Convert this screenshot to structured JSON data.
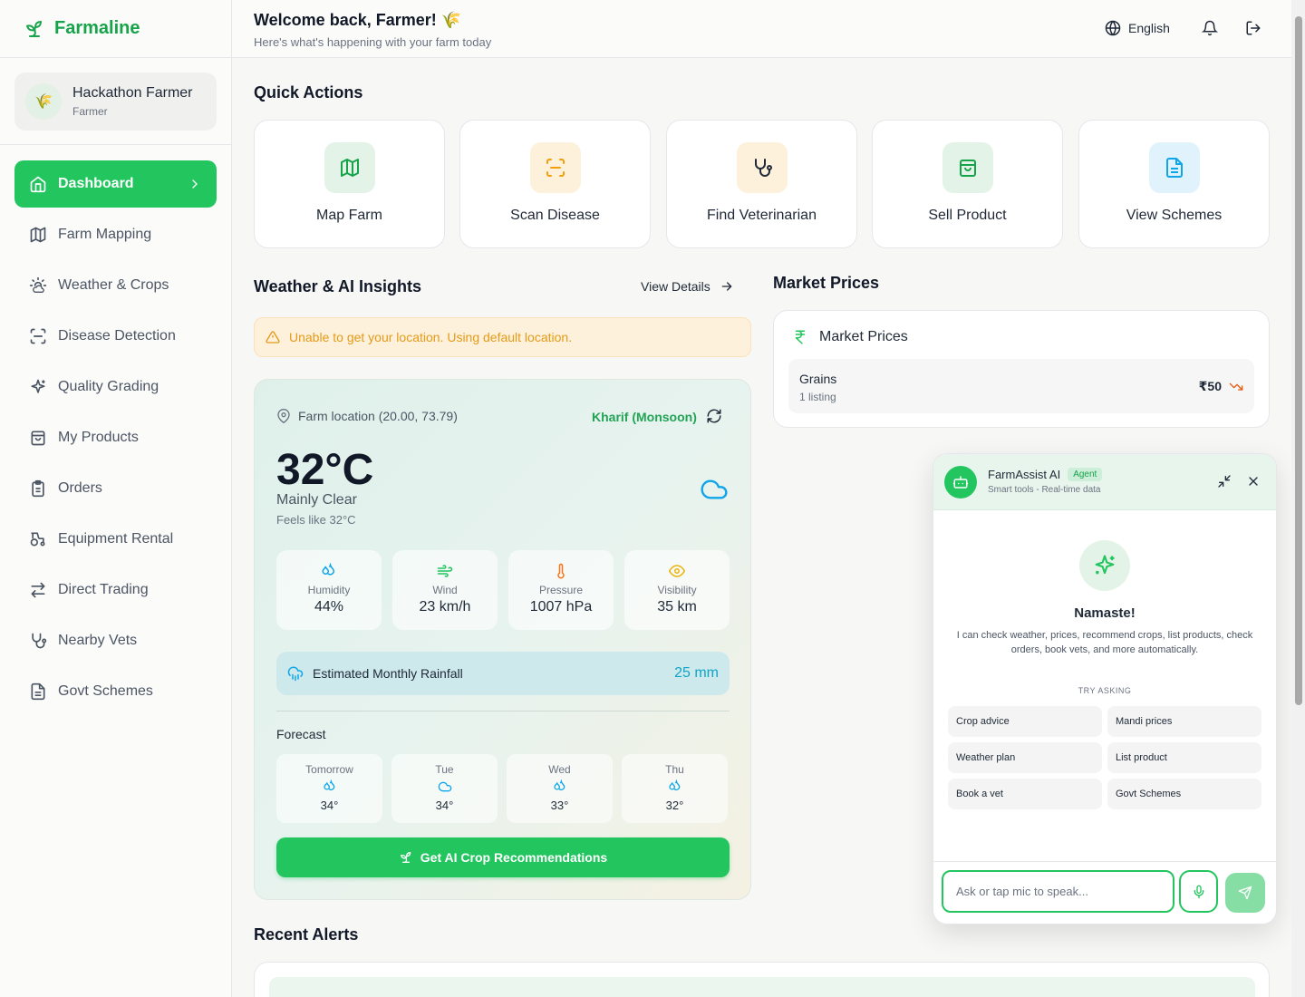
{
  "app": {
    "name": "Farmaline",
    "brand_color": "#16a34a"
  },
  "user": {
    "name": "Hackathon Farmer",
    "role": "Farmer",
    "avatar": "🌾"
  },
  "sidebar": {
    "items": [
      {
        "label": "Dashboard",
        "icon": "home-icon",
        "active": true
      },
      {
        "label": "Farm Mapping",
        "icon": "map-icon"
      },
      {
        "label": "Weather & Crops",
        "icon": "sun-cloud-icon"
      },
      {
        "label": "Disease Detection",
        "icon": "scan-icon"
      },
      {
        "label": "Quality Grading",
        "icon": "sparkles-icon"
      },
      {
        "label": "My Products",
        "icon": "bag-icon"
      },
      {
        "label": "Orders",
        "icon": "clipboard-icon"
      },
      {
        "label": "Equipment Rental",
        "icon": "tractor-icon"
      },
      {
        "label": "Direct Trading",
        "icon": "arrows-icon"
      },
      {
        "label": "Nearby Vets",
        "icon": "stethoscope-icon"
      },
      {
        "label": "Govt Schemes",
        "icon": "document-icon"
      }
    ]
  },
  "header": {
    "welcome": "Welcome back, Farmer! 🌾",
    "subtitle": "Here's what's happening with your farm today",
    "language": "English"
  },
  "quick_actions": {
    "title": "Quick Actions",
    "items": [
      {
        "label": "Map Farm",
        "icon": "map-icon",
        "color": "#16a34a"
      },
      {
        "label": "Scan Disease",
        "icon": "scan-icon",
        "color": "#f59e0b"
      },
      {
        "label": "Find Veterinarian",
        "icon": "stethoscope-icon",
        "color": "#1f2937"
      },
      {
        "label": "Sell Product",
        "icon": "bag-icon",
        "color": "#16a34a"
      },
      {
        "label": "View Schemes",
        "icon": "document-icon",
        "color": "#0ea5e9"
      }
    ]
  },
  "weather": {
    "section_title": "Weather & AI Insights",
    "view_details": "View Details",
    "warning": "Unable to get your location. Using default location.",
    "location": "Farm location (20.00, 73.79)",
    "season": "Kharif (Monsoon)",
    "temperature": "32°C",
    "condition": "Mainly Clear",
    "feels_like": "Feels like 32°C",
    "stats": [
      {
        "label": "Humidity",
        "value": "44%",
        "icon": "droplets-icon"
      },
      {
        "label": "Wind",
        "value": "23 km/h",
        "icon": "wind-icon"
      },
      {
        "label": "Pressure",
        "value": "1007 hPa",
        "icon": "thermometer-icon"
      },
      {
        "label": "Visibility",
        "value": "35 km",
        "icon": "eye-icon"
      }
    ],
    "rainfall_label": "Estimated Monthly Rainfall",
    "rainfall_value": "25 mm",
    "forecast_title": "Forecast",
    "forecast": [
      {
        "day": "Tomorrow",
        "temp": "34°",
        "icon": "droplets-icon"
      },
      {
        "day": "Tue",
        "temp": "34°",
        "icon": "cloud-icon"
      },
      {
        "day": "Wed",
        "temp": "33°",
        "icon": "droplets-icon"
      },
      {
        "day": "Thu",
        "temp": "32°",
        "icon": "droplets-icon"
      }
    ],
    "ai_button": "Get AI Crop Recommendations"
  },
  "market": {
    "section_title": "Market Prices",
    "card_title": "Market Prices",
    "rows": [
      {
        "name": "Grains",
        "count": "1 listing",
        "price": "₹50",
        "trend": "down"
      }
    ]
  },
  "alerts": {
    "title": "Recent Alerts"
  },
  "chat": {
    "title": "FarmAssist AI",
    "badge": "Agent",
    "subtitle": "Smart tools - Real-time data",
    "greeting": "Namaste!",
    "intro": "I can check weather, prices, recommend crops, list products, check orders, book vets, and more automatically.",
    "try_label": "TRY ASKING",
    "suggestions": [
      "Crop advice",
      "Mandi prices",
      "Weather plan",
      "List product",
      "Book a vet",
      "Govt Schemes"
    ],
    "input_placeholder": "Ask or tap mic to speak..."
  }
}
